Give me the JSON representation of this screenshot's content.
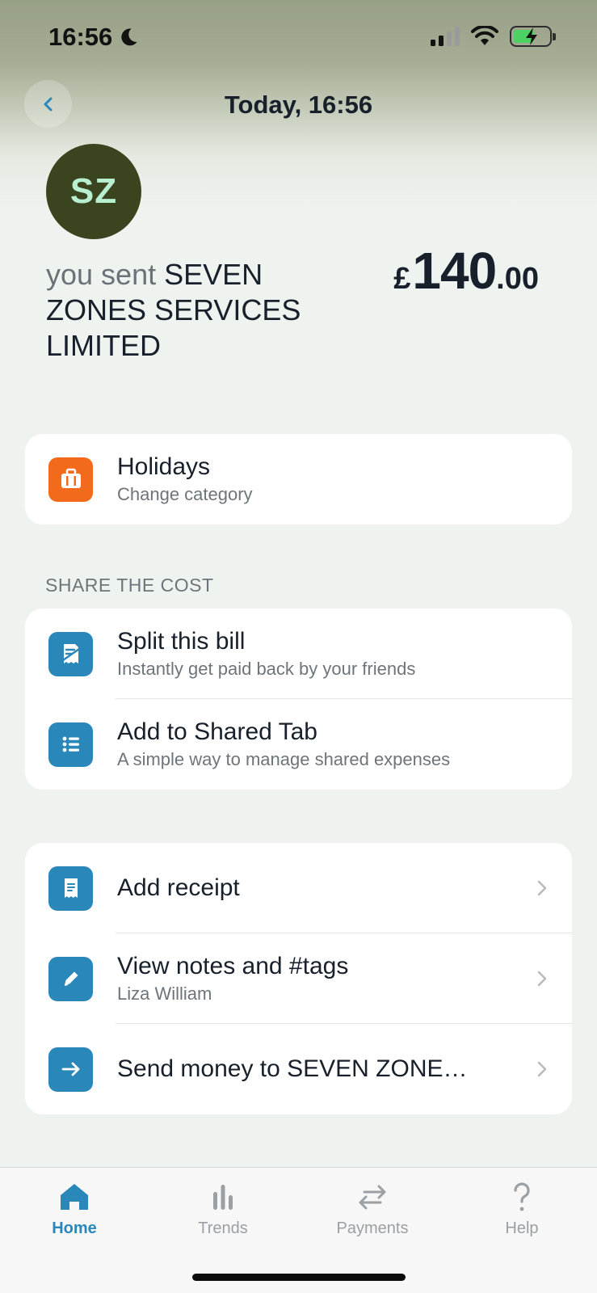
{
  "status_bar": {
    "time": "16:56"
  },
  "nav": {
    "title": "Today, 16:56"
  },
  "transaction": {
    "avatar_initials": "SZ",
    "prefix": "you sent",
    "merchant": "SEVEN ZONES SERVICES LIMITED",
    "currency_symbol": "£",
    "amount_whole": "140",
    "amount_cents": ".00"
  },
  "category": {
    "label": "Holidays",
    "action": "Change category",
    "icon": "suitcase-icon",
    "color": "#f26b1d"
  },
  "share_section": {
    "title": "SHARE THE COST",
    "items": [
      {
        "label": "Split this bill",
        "sub": "Instantly get paid back by your friends",
        "icon": "split-bill-icon"
      },
      {
        "label": "Add to Shared Tab",
        "sub": "A simple way to manage shared expenses",
        "icon": "list-icon"
      }
    ]
  },
  "actions": {
    "items": [
      {
        "label": "Add receipt",
        "sub": "",
        "icon": "receipt-icon"
      },
      {
        "label": "View notes and #tags",
        "sub": "Liza William",
        "icon": "pencil-icon"
      },
      {
        "label": "Send money to SEVEN ZONE…",
        "sub": "",
        "icon": "arrow-right-icon"
      }
    ]
  },
  "tabbar": {
    "tabs": [
      {
        "label": "Home",
        "icon": "home-icon",
        "active": true
      },
      {
        "label": "Trends",
        "icon": "bar-chart-icon",
        "active": false
      },
      {
        "label": "Payments",
        "icon": "transfer-icon",
        "active": false
      },
      {
        "label": "Help",
        "icon": "question-icon",
        "active": false
      }
    ]
  },
  "colors": {
    "accent": "#2a87b9",
    "avatar_bg": "#3a4520",
    "avatar_text": "#b8efd0",
    "category_orange": "#f26b1d"
  }
}
